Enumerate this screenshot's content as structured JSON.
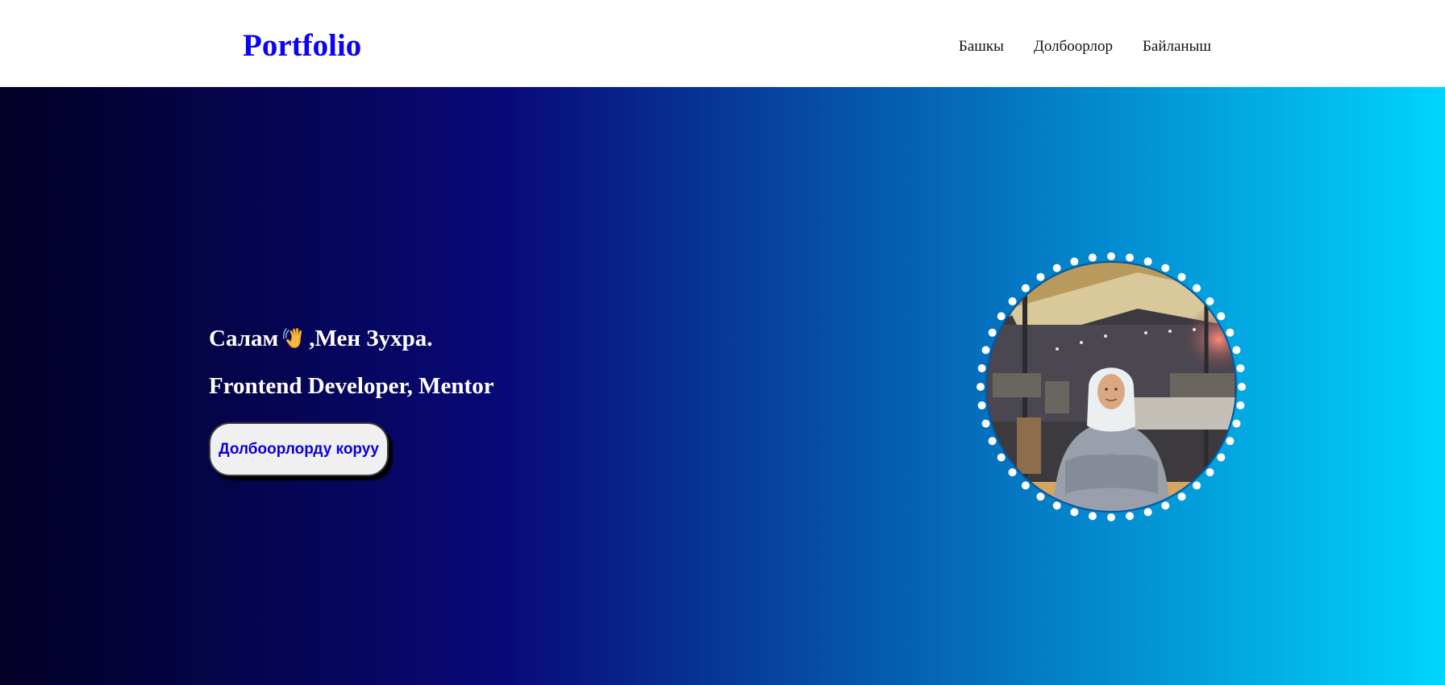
{
  "header": {
    "logo": "Portfolio",
    "nav": [
      {
        "label": "Башкы"
      },
      {
        "label": "Долбоорлор"
      },
      {
        "label": "Байланыш"
      }
    ]
  },
  "hero": {
    "greeting_before": "Салам",
    "greeting_icon": "waving-hand-icon",
    "greeting_after": ",Мен Зухра.",
    "role": "Frontend Developer, Mentor",
    "cta_label": "Долбоорлорду коруу"
  },
  "colors": {
    "logo": "#0a00f5",
    "gradient_start": "#020024",
    "gradient_mid": "#090979",
    "gradient_end": "#00d4ff",
    "cta_text": "#0a00e0",
    "cta_bg": "#f0f0f0"
  }
}
